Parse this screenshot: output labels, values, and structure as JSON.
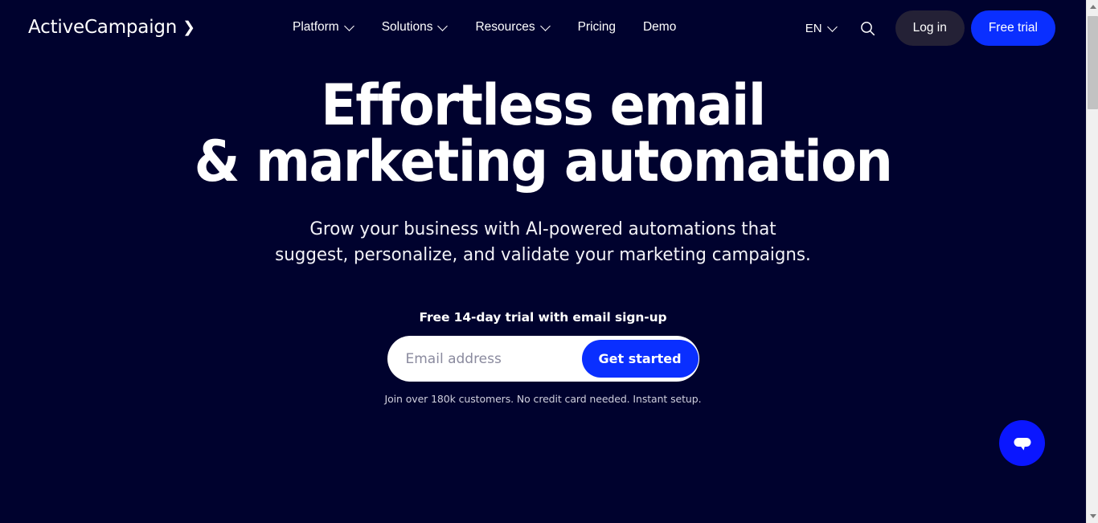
{
  "header": {
    "logo_text": "ActiveCampaign",
    "logo_mark": "❯",
    "nav": [
      {
        "label": "Platform",
        "has_dropdown": true
      },
      {
        "label": "Solutions",
        "has_dropdown": true
      },
      {
        "label": "Resources",
        "has_dropdown": true
      },
      {
        "label": "Pricing",
        "has_dropdown": false
      },
      {
        "label": "Demo",
        "has_dropdown": false
      }
    ],
    "language": "EN",
    "search_icon": "search-icon",
    "login_label": "Log in",
    "trial_label": "Free trial"
  },
  "hero": {
    "headline_line1": "Effortless email",
    "headline_line2": "& marketing automation",
    "subhead_line1": "Grow your business with AI-powered automations that",
    "subhead_line2": "suggest, personalize, and validate your marketing campaigns.",
    "trial_note": "Free 14-day trial with email sign-up",
    "email_placeholder": "Email address",
    "email_value": "",
    "cta_label": "Get started",
    "fineprint": "Join over 180k customers. No credit card needed. Instant setup."
  },
  "chat": {
    "icon": "chat-bubble-icon"
  },
  "colors": {
    "background": "#00022e",
    "accent_blue": "#0a2fff",
    "login_pill": "#242136",
    "chat_blue": "#0a16ff",
    "text_primary": "#ffffff",
    "fineprint": "#cfcfdd",
    "placeholder": "#8a8a9e",
    "scrollbar_track": "#f0f0f0",
    "scrollbar_thumb": "#c2c2c2"
  }
}
